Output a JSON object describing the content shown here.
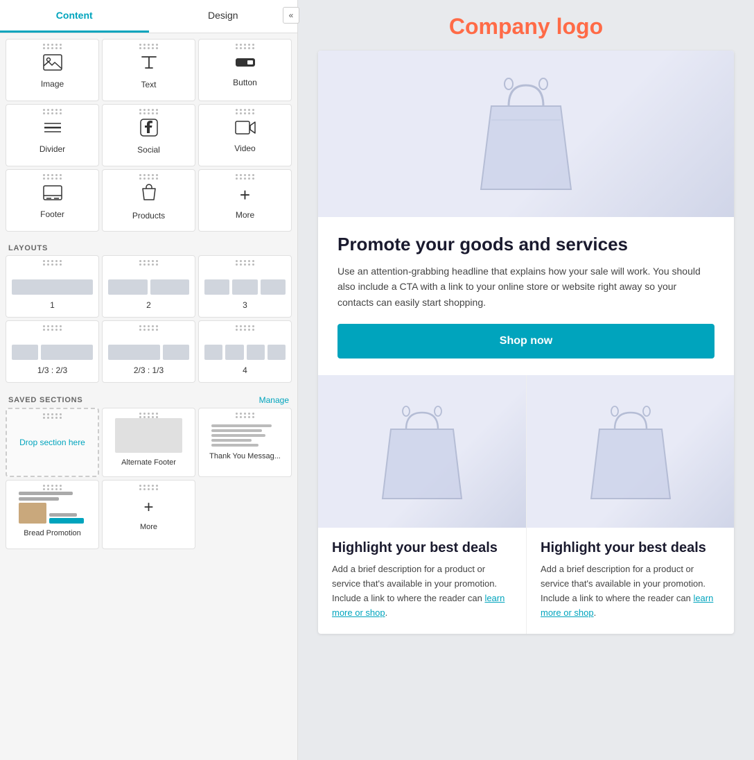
{
  "panel": {
    "tabs": [
      {
        "label": "Content",
        "active": true
      },
      {
        "label": "Design",
        "active": false
      }
    ],
    "elements": [
      {
        "name": "image",
        "icon": "🖼",
        "label": "Image"
      },
      {
        "name": "text",
        "icon": "📝",
        "label": "Text"
      },
      {
        "name": "button",
        "icon": "🔲",
        "label": "Button"
      },
      {
        "name": "divider",
        "icon": "☰",
        "label": "Divider"
      },
      {
        "name": "social",
        "icon": "#️⃣",
        "label": "Social"
      },
      {
        "name": "video",
        "icon": "📹",
        "label": "Video"
      },
      {
        "name": "footer",
        "icon": "▤",
        "label": "Footer"
      },
      {
        "name": "products",
        "icon": "📦",
        "label": "Products"
      },
      {
        "name": "more",
        "icon": "+",
        "label": "More"
      }
    ],
    "layouts_label": "LAYOUTS",
    "layouts": [
      {
        "label": "1",
        "cols": [
          1
        ]
      },
      {
        "label": "2",
        "cols": [
          1,
          1
        ]
      },
      {
        "label": "3",
        "cols": [
          1,
          1,
          1
        ]
      },
      {
        "label": "1/3 : 2/3",
        "cols": [
          1,
          2
        ]
      },
      {
        "label": "2/3 : 1/3",
        "cols": [
          2,
          1
        ]
      },
      {
        "label": "4",
        "cols": [
          1,
          1,
          1,
          1
        ]
      }
    ],
    "saved_sections_label": "SAVED SECTIONS",
    "manage_label": "Manage",
    "saved_items": [
      {
        "label": "Drop section here",
        "type": "drop"
      },
      {
        "label": "Alternate Footer",
        "type": "preview"
      },
      {
        "label": "Thank You Messag...",
        "type": "preview"
      },
      {
        "label": "Bread Promotion",
        "type": "bread"
      },
      {
        "label": "More",
        "type": "more-btn"
      }
    ]
  },
  "email": {
    "company_logo": "Company logo",
    "hero_alt": "Shopping bag hero image",
    "promo_title": "Promote your goods and services",
    "promo_desc": "Use an attention-grabbing headline that explains how your sale will work. You should also include a CTA with a link to your online store or website right away so your contacts can easily start shopping.",
    "shop_now": "Shop now",
    "col1_title": "Highlight your best deals",
    "col1_desc": "Add a brief description for a product or service that's available in your promotion. Include a link to where the reader can",
    "col1_link": "learn more or shop",
    "col2_title": "Highlight your best deals",
    "col2_desc": "Add a brief description for a product or service that's available in your promotion. Include a link to where the reader can",
    "col2_link": "learn more or shop"
  }
}
